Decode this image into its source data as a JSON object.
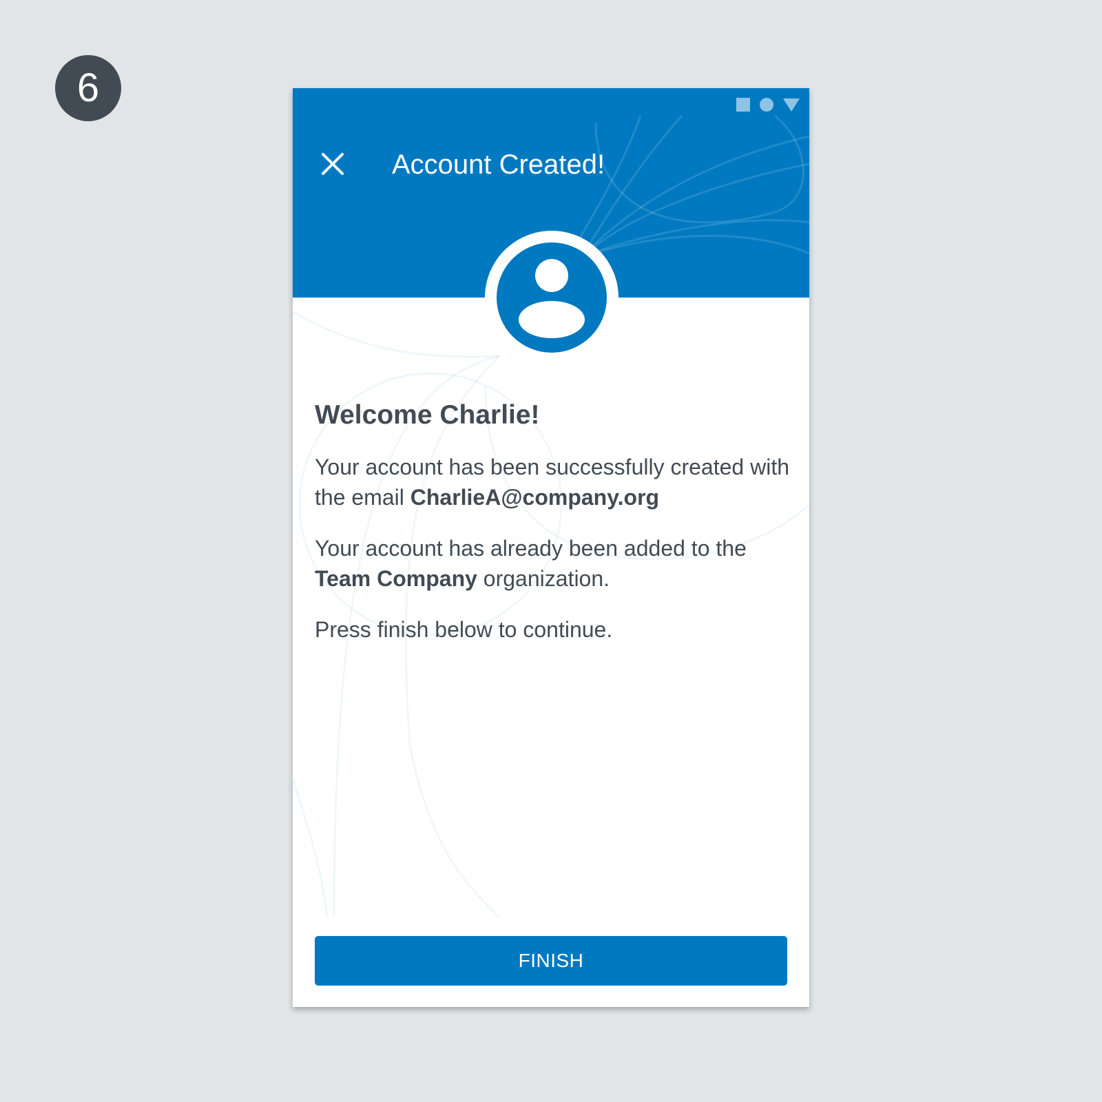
{
  "step": {
    "number": "6"
  },
  "header": {
    "title": "Account Created!",
    "close_icon": "close-icon",
    "status_icons": [
      "square-icon",
      "circle-icon",
      "triangle-icon"
    ]
  },
  "avatar": {
    "icon": "user-icon"
  },
  "content": {
    "welcome": "Welcome Charlie!",
    "para1_text": "Your account has been successfully created with the email ",
    "email": "CharlieA@company.org",
    "para2_text_before": "Your account has already been added to the ",
    "organization": "Team Company",
    "para2_text_after": " organization.",
    "para3": "Press finish below to continue."
  },
  "finish_button": {
    "label": "FINISH"
  },
  "colors": {
    "primary": "#0079c1",
    "text": "#424b53",
    "background": "#e1e5e7",
    "badge": "#424b53"
  }
}
